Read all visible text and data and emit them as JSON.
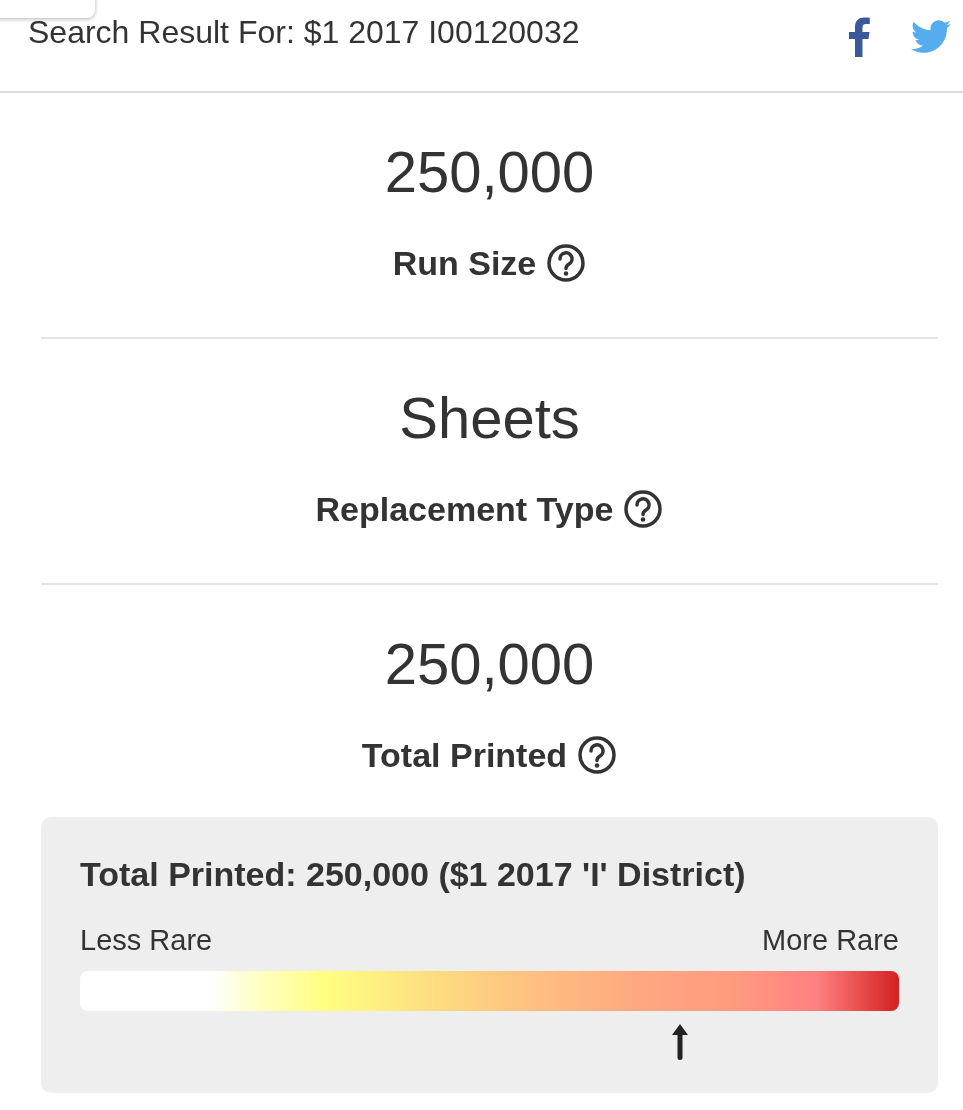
{
  "header": {
    "title": "Search Result For: $1 2017 I00120032"
  },
  "stats": [
    {
      "value": "250,000",
      "label": "Run Size"
    },
    {
      "value": "Sheets",
      "label": "Replacement Type"
    },
    {
      "value": "250,000",
      "label": "Total Printed"
    }
  ],
  "rarity": {
    "title": "Total Printed: 250,000 ($1 2017 'I' District)",
    "low_label": "Less Rare",
    "high_label": "More Rare",
    "level": 0.733
  }
}
